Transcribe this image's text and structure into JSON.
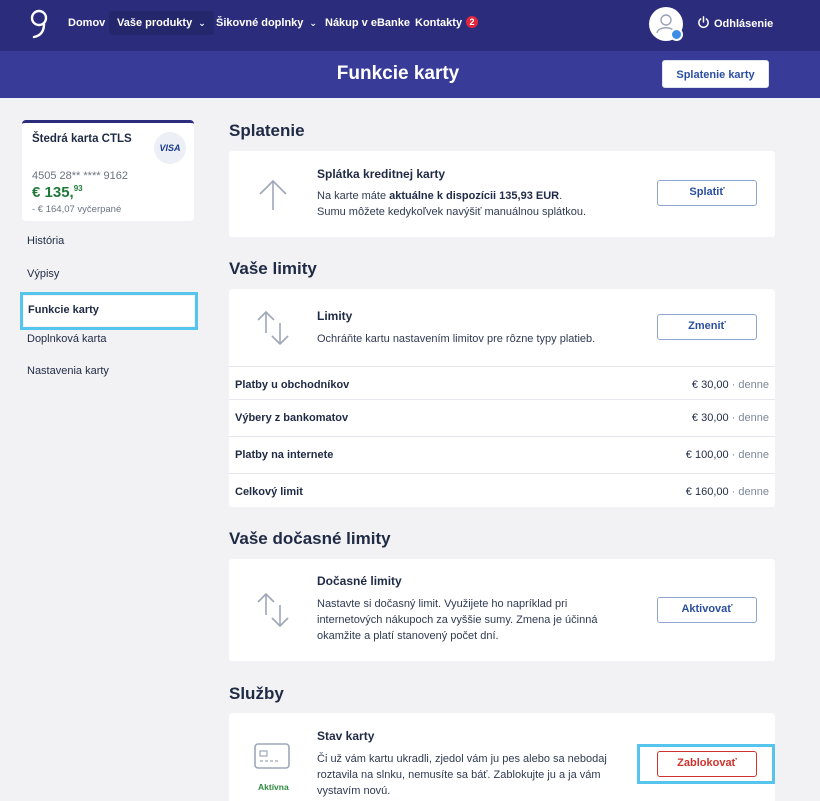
{
  "nav": {
    "items": [
      {
        "label": "Domov"
      },
      {
        "label": "Vaše produkty",
        "chevron": "chevron-down-icon"
      },
      {
        "label": "Šikovné doplnky",
        "chevron": "chevron-down-icon"
      },
      {
        "label": "Nákup v eBanke"
      },
      {
        "label": "Kontakty",
        "badge": "2"
      }
    ],
    "logout_label": "Odhlásenie"
  },
  "header": {
    "title": "Funkcie karty",
    "repay_button": "Splatenie karty"
  },
  "card": {
    "name": "Štedrá karta CTLS",
    "brand": "VISA",
    "number": "4505 28** **** 9162",
    "balance_main": "€ 135,",
    "balance_cents": "93",
    "used": "- € 164,07 vyčerpané"
  },
  "sidebar": {
    "items": [
      {
        "label": "História"
      },
      {
        "label": "Výpisy"
      },
      {
        "label": "Funkcie karty"
      },
      {
        "label": "Doplnková karta"
      },
      {
        "label": "Nastavenia karty"
      }
    ]
  },
  "sections": {
    "repayment": {
      "heading": "Splatenie",
      "title": "Splátka kreditnej karty",
      "text_pre": "Na karte máte ",
      "text_bold": "aktuálne k dispozícii 135,93 EUR",
      "text_post": ".",
      "text_line2": "Sumu môžete kedykoľvek navýšiť manuálnou splátkou.",
      "button": "Splatiť"
    },
    "limits": {
      "heading": "Vaše limity",
      "title": "Limity",
      "text": "Ochráňte kartu nastavením limitov pre rôzne typy platieb.",
      "button": "Zmeniť",
      "rows": [
        {
          "label": "Platby u obchodníkov",
          "value": "€ 30,00",
          "unit": " · denne"
        },
        {
          "label": "Výbery z bankomatov",
          "value": "€ 30,00",
          "unit": " · denne"
        },
        {
          "label": "Platby na internete",
          "value": "€ 100,00",
          "unit": " · denne"
        },
        {
          "label": "Celkový limit",
          "value": "€ 160,00",
          "unit": " · denne"
        }
      ]
    },
    "temp_limits": {
      "heading": "Vaše dočasné limity",
      "title": "Dočasné limity",
      "line1": "Nastavte si dočasný limit. Využijete ho napríklad pri",
      "line2": "internetových nákupoch za vyššie sumy. Zmena je účinná",
      "line3": "okamžite a platí stanovený počet dní.",
      "button": "Aktivovať"
    },
    "services": {
      "heading": "Služby",
      "title": "Stav karty",
      "line1": "Či už vám kartu ukradli, zjedol vám ju pes alebo sa nebodaj",
      "line2": "roztavila na slnku, nemusíte sa báť. Zablokujte ju a ja vám",
      "line3": "vystavím novú.",
      "status": "Aktívna",
      "button": "Zablokovať"
    }
  },
  "colors": {
    "nav_bg": "#2b2d7c",
    "band_bg": "#383b98",
    "highlight": "#56c5ee",
    "danger": "#d0322d",
    "positive": "#1f7a3a"
  }
}
